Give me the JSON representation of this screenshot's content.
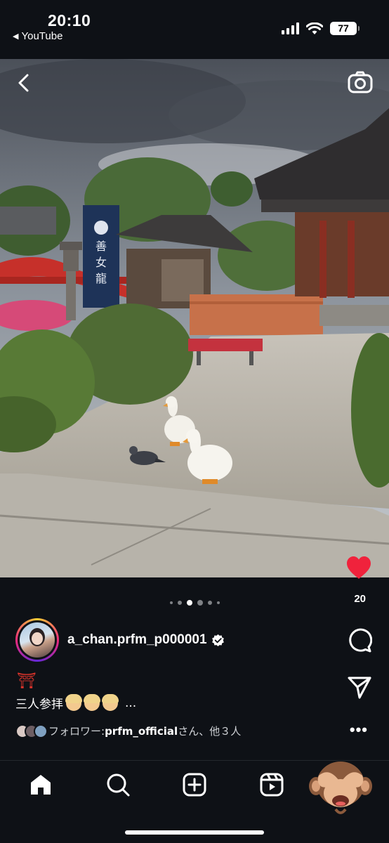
{
  "status_bar": {
    "time": "20:10",
    "back_app": "YouTube",
    "battery": "77"
  },
  "post": {
    "likes": "20",
    "carousel": {
      "count": 6,
      "active_index": 2
    },
    "author": {
      "username": "a_chan.prfm_p000001"
    },
    "caption_emoji": "⛩",
    "caption": "三人参拝",
    "caption_more": "...",
    "followers_prefix": "フォロワー: ",
    "followers_handle": "prfm_official",
    "followers_suffix": "さん、他３人"
  },
  "icons": {
    "back": "chevron-left-icon",
    "camera": "camera-icon",
    "like": "heart-icon",
    "comment": "comment-icon",
    "share": "paper-plane-icon",
    "more": "more-icon",
    "verified": "verified-badge-icon"
  },
  "nav": [
    "home",
    "search",
    "create",
    "reels",
    "profile"
  ],
  "colors": {
    "like": "#f0223c",
    "background": "#0e1116"
  }
}
